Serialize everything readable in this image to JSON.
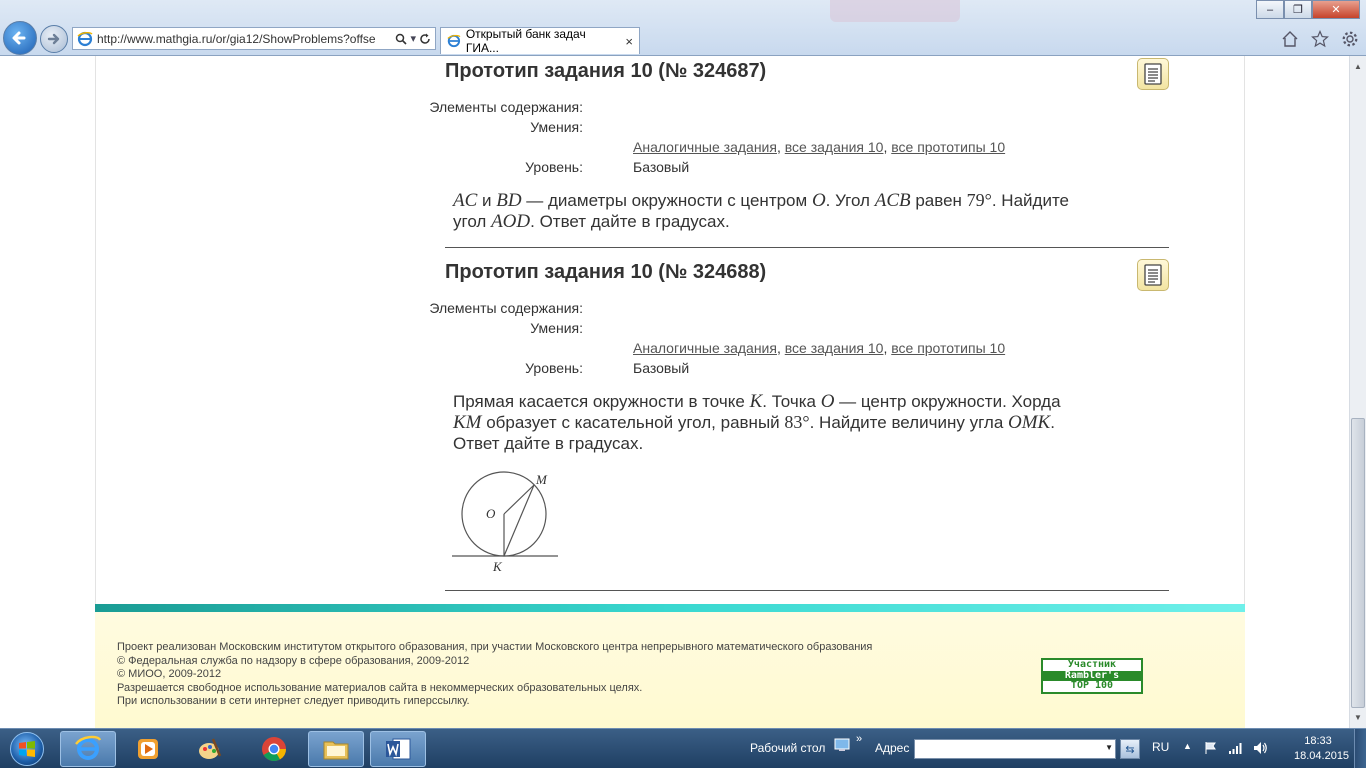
{
  "browser": {
    "url": "http://www.mathgia.ru/or/gia12/ShowProblems?offse",
    "tab_title": "Открытый банк задач ГИА...",
    "tab_close": "×",
    "window_controls": [
      "–",
      "❐",
      "✕"
    ]
  },
  "problems": [
    {
      "title": "Прототип задания 10 (№ 324687)",
      "labels": {
        "content": "Элементы содержания:",
        "skills": "Умения:",
        "level": "Уровень:"
      },
      "links": [
        "Аналогичные задания",
        "все задания 10",
        "все прототипы 10"
      ],
      "link_sep": ", ",
      "level": "Базовый",
      "text": {
        "p1": "AC",
        "t1": " и ",
        "p2": "BD",
        "t2": " — диаметры окружности с центром ",
        "p3": "O",
        "t3": ". Угол ",
        "p4": "ACB",
        "t4": " равен ",
        "n1": "79°",
        "t5": ". Найдите",
        "t6": "угол ",
        "p5": "AOD",
        "t7": ". Ответ дайте в градусах."
      }
    },
    {
      "title": "Прототип задания 10 (№ 324688)",
      "labels": {
        "content": "Элементы содержания:",
        "skills": "Умения:",
        "level": "Уровень:"
      },
      "links": [
        "Аналогичные задания",
        "все задания 10",
        "все прототипы 10"
      ],
      "link_sep": ", ",
      "level": "Базовый",
      "text": {
        "t1": "Прямая касается окружности в точке ",
        "p1": "K",
        "t2": ". Точка ",
        "p2": "O",
        "t3": " — центр окружности. Хорда",
        "p3": "KM",
        "t4": " образует с касательной угол, равный ",
        "n1": "83°",
        "t5": ". Найдите величину угла ",
        "p4": "OMK",
        "t6": ".",
        "t7": "Ответ дайте в градусах."
      },
      "figure_labels": {
        "m": "M",
        "o": "O",
        "k": "K"
      }
    }
  ],
  "footer": {
    "lines": [
      "Проект реализован Московским институтом открытого образования, при участии Московского центра непрерывного математического образования",
      "© Федеральная служба по надзору в сфере образования, 2009-2012",
      "© МИОО, 2009-2012",
      "Разрешается свободное использование материалов сайта в некоммерческих образовательных целях.",
      "При использовании в сети интернет следует приводить гиперссылку."
    ],
    "rambler": [
      "Участник",
      "Rambler's",
      "TOP 100"
    ]
  },
  "taskbar": {
    "desktop_label": "Рабочий стол",
    "chevron": "»",
    "address_label": "Адрес",
    "lang": "RU",
    "time": "18:33",
    "date": "18.04.2015"
  },
  "colors": {
    "teal": "#39d8d0",
    "footer_bg": "#fffbe0",
    "rambler_green": "#2a8a2a"
  }
}
